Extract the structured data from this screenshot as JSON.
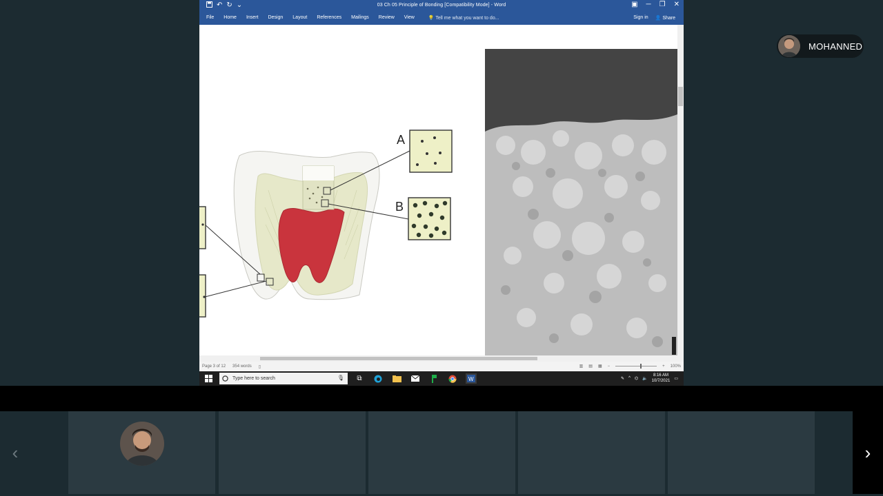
{
  "word": {
    "title": "03 Ch 05 Principle of Bonding [Compatibility Mode] - Word",
    "quick_access": {
      "save_icon": "save-icon",
      "undo_icon": "undo-icon",
      "redo_icon": "redo-icon",
      "customize": "⌄"
    },
    "window_controls": {
      "ribbon_options": "▣",
      "minimize": "─",
      "restore": "❐",
      "close": "✕"
    },
    "ribbon_tabs": [
      "File",
      "Home",
      "Insert",
      "Design",
      "Layout",
      "References",
      "Mailings",
      "Review",
      "View"
    ],
    "tell_me": "Tell me what you want to do...",
    "sign_in": "Sign in",
    "share": "Share",
    "figure": {
      "label_a": "A",
      "label_b": "B"
    },
    "status": {
      "page": "Page 3 of 12",
      "words": "354 words",
      "zoom": "100%"
    }
  },
  "taskbar": {
    "search_placeholder": "Type here to search",
    "time": "8:16 AM",
    "date": "10/7/2021"
  },
  "participant": {
    "name": "MOHANNED"
  },
  "nav": {
    "prev": "‹",
    "next": "›"
  },
  "colors": {
    "word_blue": "#2b579a",
    "background": "#1c2b31",
    "tile": "#2b3a41",
    "pulp": "#c9343d",
    "dentin": "#e6e8c9"
  }
}
